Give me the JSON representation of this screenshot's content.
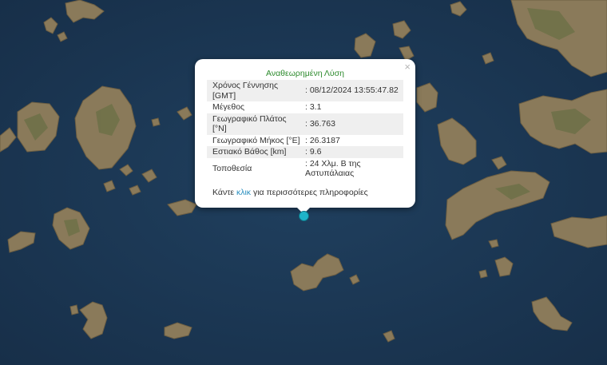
{
  "map": {
    "sea_color": "#1d3a57",
    "land_color": "#8a7a5a",
    "marker_color": "#1fb3c8"
  },
  "popup": {
    "title": "Αναθεωρημένη Λύση",
    "close_label": "×",
    "rows": [
      {
        "label": "Χρόνος Γέννησης [GMT]",
        "value": ": 08/12/2024 13:55:47.82"
      },
      {
        "label": "Μέγεθος",
        "value": ": 3.1"
      },
      {
        "label": "Γεωγραφικό Πλάτος [°N]",
        "value": ": 36.763"
      },
      {
        "label": "Γεωγραφικό Μήκος [°E]",
        "value": ": 26.3187"
      },
      {
        "label": "Εστιακό Βάθος [km]",
        "value": ": 9.6"
      },
      {
        "label": "Τοποθεσία",
        "value": ": 24 Χλμ. Β της Αστυπάλαιας"
      }
    ],
    "more_prefix": "Κάντε ",
    "more_link": "κλικ",
    "more_suffix": " για περισσότερες πληροφορίες",
    "title_color": "#2e8b2e",
    "link_color": "#2a8fbf"
  }
}
